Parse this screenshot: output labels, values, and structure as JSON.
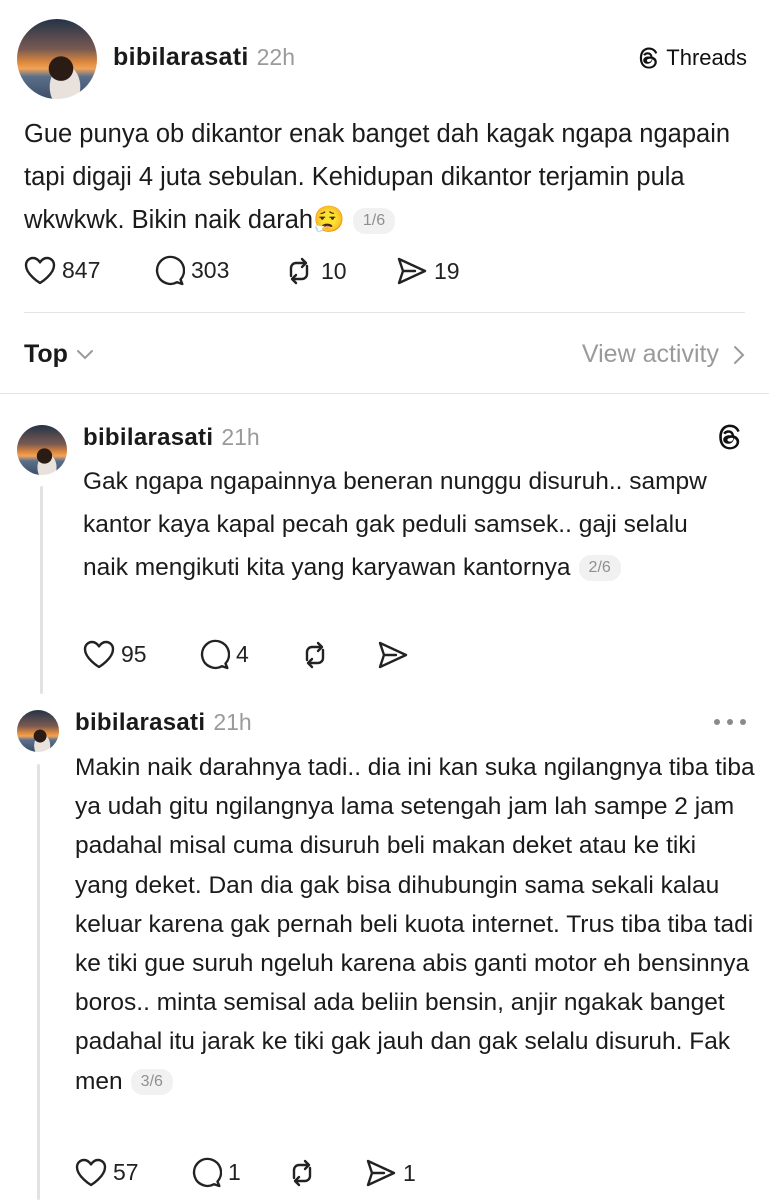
{
  "post": {
    "username": "bibilarasati",
    "time": "22h",
    "brand_label": "Threads",
    "text": "Gue punya ob dikantor enak banget dah kagak ngapa ngapain tapi digaji 4 juta sebulan. Kehidupan dikantor terjamin pula wkwkwk. Bikin naik darah",
    "emoji": "😮‍💨",
    "counter": "1/6",
    "likes": "847",
    "replies": "303",
    "reposts": "10",
    "shares": "19"
  },
  "sort": {
    "label": "Top",
    "view_activity": "View activity"
  },
  "replies": [
    {
      "username": "bibilarasati",
      "time": "21h",
      "text": "Gak ngapa ngapainnya beneran nunggu disuruh.. sampw kantor kaya kapal pecah gak peduli samsek.. gaji selalu naik mengikuti kita yang karyawan kantornya",
      "counter": "2/6",
      "likes": "95",
      "replies": "4",
      "reposts": "",
      "shares": ""
    },
    {
      "username": "bibilarasati",
      "time": "21h",
      "text": "Makin naik darahnya tadi.. dia ini kan suka ngilangnya tiba tiba ya udah gitu ngilangnya lama setengah jam lah sampe 2 jam padahal misal cuma disuruh beli makan deket atau ke tiki yang deket. Dan dia gak bisa dihubungin sama sekali kalau keluar karena gak pernah beli kuota internet. Trus tiba tiba tadi ke tiki gue suruh ngeluh karena abis ganti motor eh bensinnya boros.. minta semisal ada beliin bensin, anjir ngakak banget padahal itu jarak ke tiki gak jauh dan gak selalu disuruh. Fak men",
      "counter": "3/6",
      "likes": "57",
      "replies": "1",
      "reposts": "",
      "shares": "1"
    }
  ],
  "icons": {
    "like": "heart-icon",
    "reply": "comment-icon",
    "repost": "repost-icon",
    "share": "send-icon",
    "threads": "threads-logo-icon",
    "more": "more-icon",
    "chevron_down": "chevron-down-icon",
    "chevron_right": "chevron-right-icon"
  }
}
